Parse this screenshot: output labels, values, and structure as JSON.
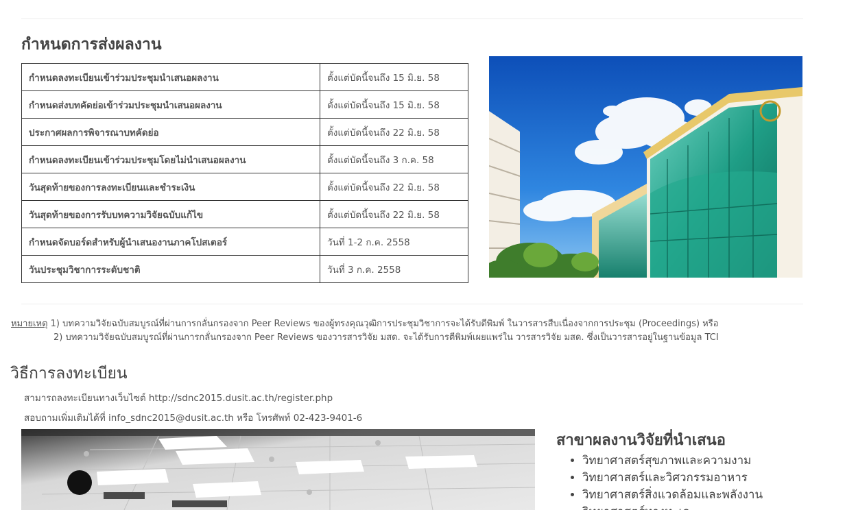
{
  "schedule": {
    "title": "กำหนดการส่งผลงาน",
    "rows": [
      {
        "item": "กำหนดลงทะเบียนเข้าร่วมประชุมนำเสนอผลงาน",
        "date": "ตั้งแต่บัดนี้จนถึง 15 มิ.ย. 58"
      },
      {
        "item": "กำหนดส่งบทคัดย่อเข้าร่วมประชุมนำเสนอผลงาน",
        "date": "ตั้งแต่บัดนี้จนถึง 15 มิ.ย. 58"
      },
      {
        "item": "ประกาศผลการพิจารณาบทคัดย่อ",
        "date": "ตั้งแต่บัดนี้จนถึง 22 มิ.ย. 58"
      },
      {
        "item": "กำหนดลงทะเบียนเข้าร่วมประชุมโดยไม่นำเสนอผลงาน",
        "date": "ตั้งแต่บัดนี้จนถึง 3 ก.ค. 58"
      },
      {
        "item": "วันสุดท้ายของการลงทะเบียนและชำระเงิน",
        "date": "ตั้งแต่บัดนี้จนถึง 22 มิ.ย. 58"
      },
      {
        "item": "วันสุดท้ายของการรับบทความวิจัยฉบับแก้ไข",
        "date": "ตั้งแต่บัดนี้จนถึง 22 มิ.ย. 58"
      },
      {
        "item": "กำหนดจัดบอร์ดสำหรับผู้นำเสนองานภาคโปสเตอร์",
        "date": "วันที่ 1-2 ก.ค. 2558"
      },
      {
        "item": "วันประชุมวิชาการระดับชาติ",
        "date": "วันที่ 3 ก.ค. 2558"
      }
    ]
  },
  "remarks": {
    "label": "หมายเหตุ",
    "line1": "1) บทความวิจัยฉบับสมบูรณ์ที่ผ่านการกลั่นกรองจาก Peer Reviews ของผู้ทรงคุณวุฒิการประชุมวิชาการจะได้รับตีพิมพ์ ในวารสารสืบเนื่องจากการประชุม (Proceedings) หรือ",
    "line2": "2) บทความวิจัยฉบับสมบูรณ์ที่ผ่านการกลั่นกรองจาก Peer Reviews ของวารสารวิจัย มสด. จะได้รับการตีพิมพ์เผยแพร่ใน วารสารวิจัย มสด. ซึ่งเป็นวารสารอยู่ในฐานข้อมูล TCI"
  },
  "registration": {
    "title": "วิธีการลงทะเบียน",
    "line1": "สามารถลงทะเบียนทางเว็บไซต์ http://sdnc2015.dusit.ac.th/register.php",
    "line2": "สอบถามเพิ่มเติมได้ที่ info_sdnc2015@dusit.ac.th หรือ โทรศัพท์ 02-423-9401-6"
  },
  "fields": {
    "title": "สาขาผลงานวิจัยที่นำเสนอ",
    "items": [
      "วิทยาศาสตร์สุขภาพและความงาม",
      "วิทยาศาสตร์และวิศวกรรมอาหาร",
      "วิทยาศาสตร์สิ่งแวดล้อมและพลังงาน",
      "วิทยาศาสตร์ทางทะเล"
    ]
  },
  "colors": {
    "sky": "#1d6fd1",
    "glass": "#2fa58b",
    "heading": "#444444",
    "text": "#555555"
  }
}
